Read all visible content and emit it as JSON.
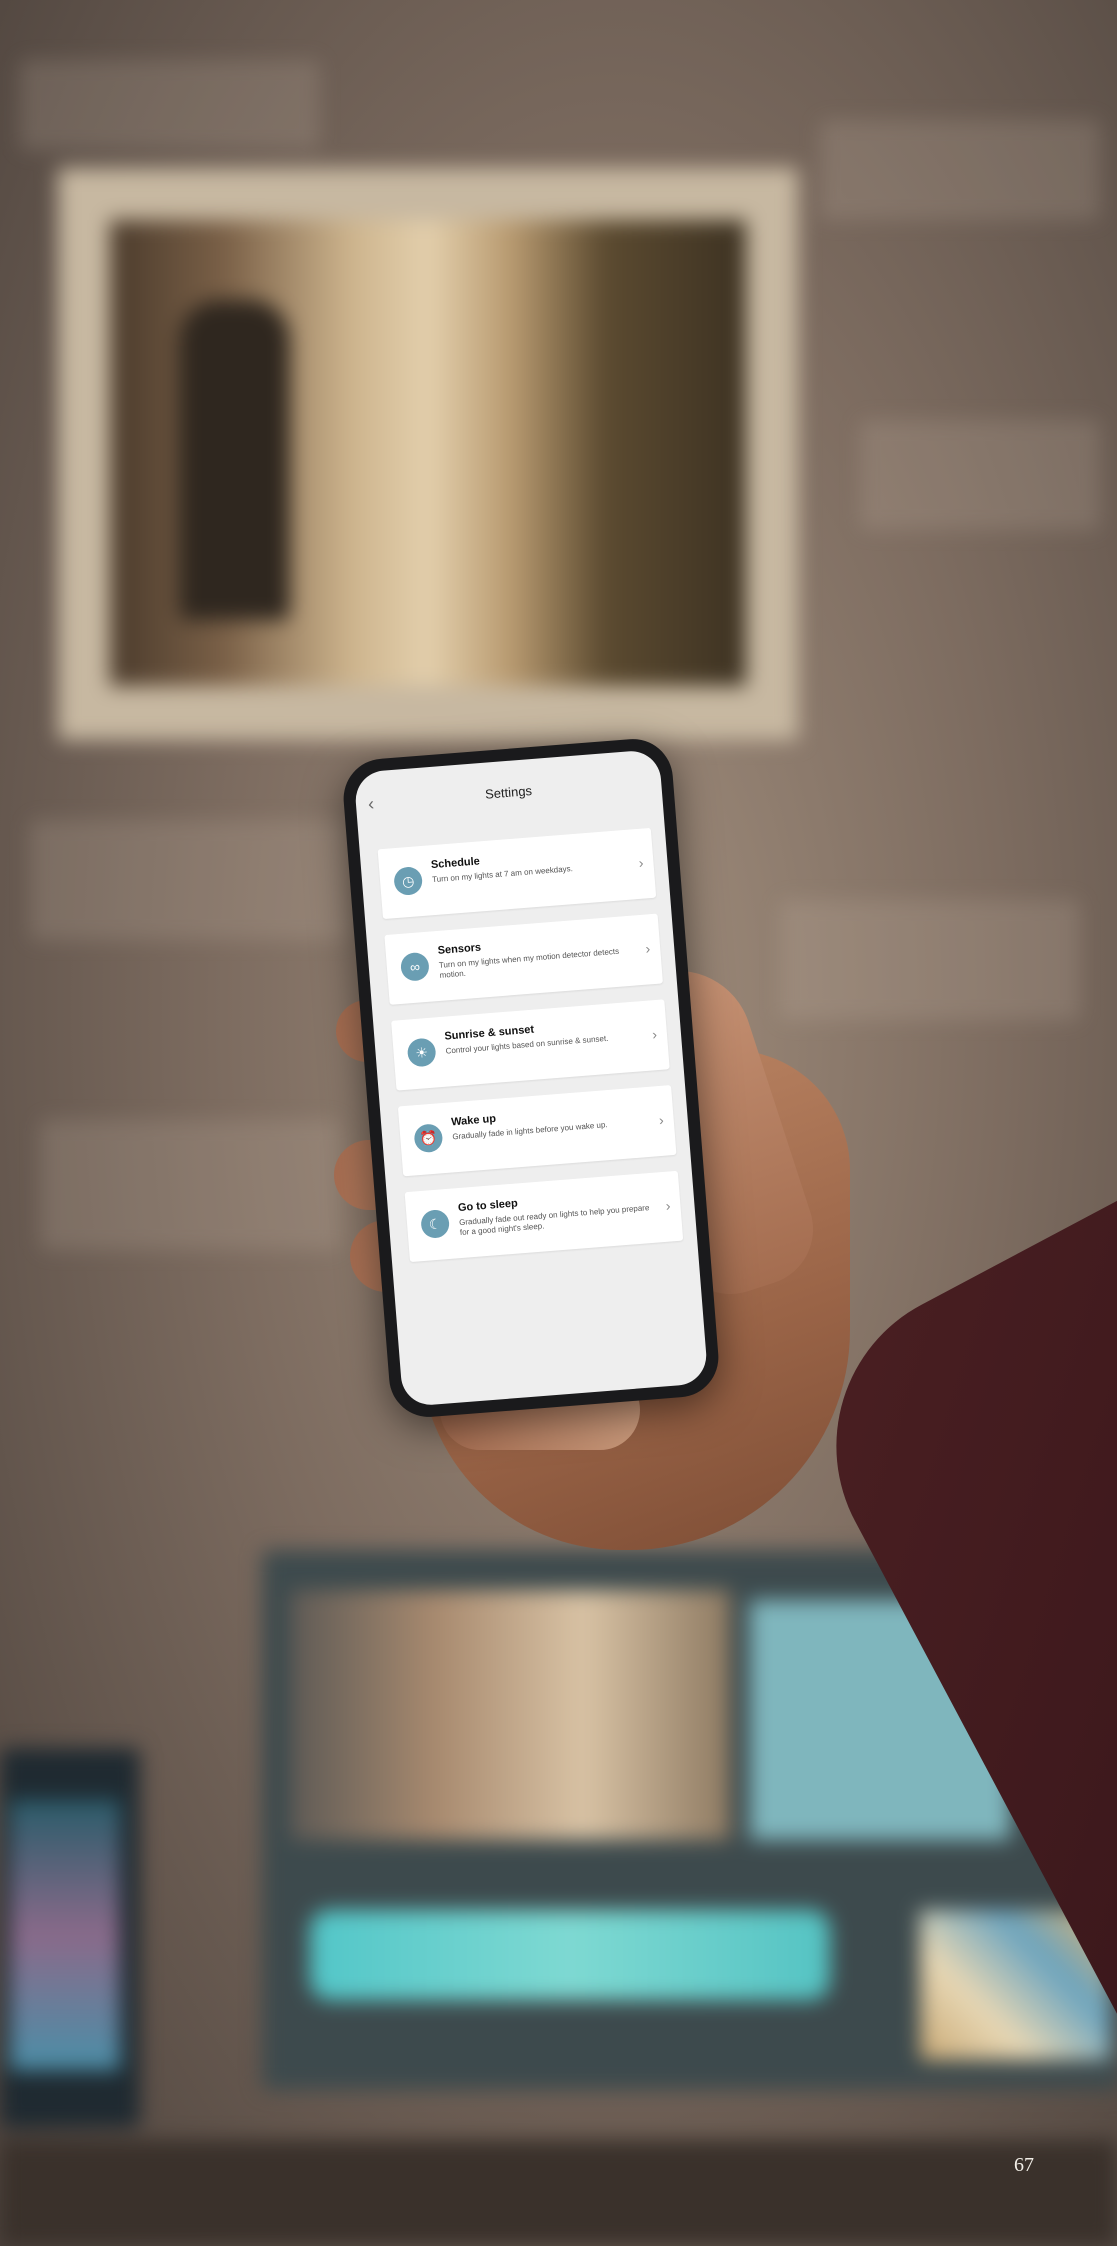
{
  "app": {
    "title": "Settings",
    "back_icon": "chevron-left-icon"
  },
  "settings": [
    {
      "title": "Schedule",
      "description": "Turn on my lights at 7 am on weekdays.",
      "icon": "clock-icon"
    },
    {
      "title": "Sensors",
      "description": "Turn on my lights when my motion detector detects motion.",
      "icon": "link-icon"
    },
    {
      "title": "Sunrise & sunset",
      "description": "Control your lights based on sunrise & sunset.",
      "icon": "sunrise-icon"
    },
    {
      "title": "Wake up",
      "description": "Gradually fade in lights before you wake up.",
      "icon": "alarm-clock-icon"
    },
    {
      "title": "Go to sleep",
      "description": "Gradually fade out ready on lights to help you prepare for a good night's sleep.",
      "icon": "moon-icon"
    }
  ],
  "page": {
    "number": "67"
  },
  "colors": {
    "icon_bg": "#6a9eb3",
    "card_bg": "#ffffff",
    "screen_bg": "#eeeeee"
  }
}
